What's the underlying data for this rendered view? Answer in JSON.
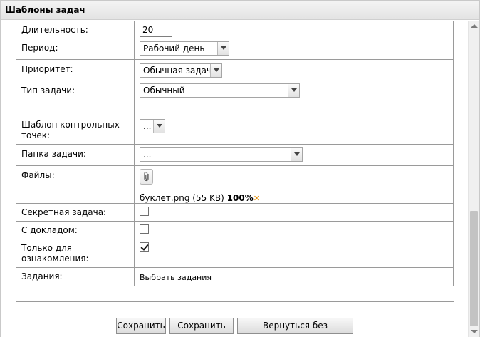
{
  "window": {
    "title": "Шаблоны задач"
  },
  "form": {
    "duration": {
      "label": "Длительность:",
      "value": "20"
    },
    "period": {
      "label": "Период:",
      "value": "Рабочий день"
    },
    "priority": {
      "label": "Приоритет:",
      "value": "Обычная задача"
    },
    "task_type": {
      "label": "Тип задачи:",
      "value": "Обычный"
    },
    "checkpoint_template": {
      "label": "Шаблон контрольных точек:",
      "value": "..."
    },
    "task_folder": {
      "label": "Папка задачи:",
      "value": "..."
    },
    "files": {
      "label": "Файлы:",
      "attach_icon": "paperclip-icon",
      "file_name": "буклет.png",
      "file_size": "(55 KB)",
      "progress": "100%",
      "remove_icon": "close-icon",
      "remove_color": "#e08a00"
    },
    "secret": {
      "label": "Секретная задача:",
      "checked": false
    },
    "with_report": {
      "label": "С докладом:",
      "checked": false
    },
    "info_only": {
      "label": "Только для ознакомления:",
      "checked": true
    },
    "tasks": {
      "label": "Задания:",
      "link": "Выбрать задания"
    }
  },
  "buttons": {
    "save": "Сохранить",
    "save_as": "Сохранить как",
    "back": "Вернуться без сохранения"
  }
}
